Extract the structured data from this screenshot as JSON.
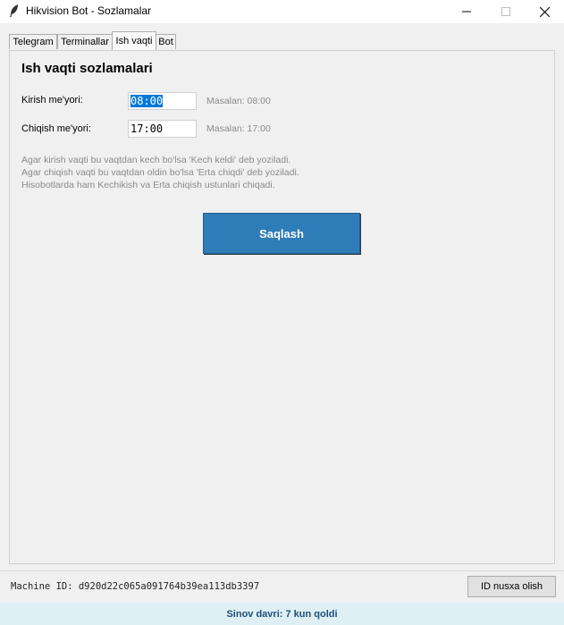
{
  "window": {
    "title": "Hikvision Bot - Sozlamalar"
  },
  "tabs": [
    {
      "label": "Telegram"
    },
    {
      "label": "Terminallar"
    },
    {
      "label": "Ish vaqti"
    },
    {
      "label": "Bot"
    }
  ],
  "settings": {
    "heading": "Ish vaqti sozlamalari",
    "checkin": {
      "label": "Kirish me'yori:",
      "value": "08:00",
      "hint": "Masalan: 08:00"
    },
    "checkout": {
      "label": "Chiqish me'yori:",
      "value": "17:00",
      "hint": "Masalan: 17:00"
    },
    "info": [
      "Agar kirish vaqti bu vaqtdan kech bo'lsa 'Kech keldi' deb yoziladi.",
      "Agar chiqish vaqti bu vaqtdan oldin bo'lsa 'Erta chiqdi' deb yoziladi.",
      "Hisobotlarda ham Kechikish va Erta chiqish ustunlari chiqadi."
    ],
    "save_label": "Saqlash"
  },
  "footer": {
    "machine_id": "Machine ID: d920d22c065a091764b39ea113db3397",
    "copy_label": "ID nusxa olish",
    "status": "Sinov davri: 7 kun qoldi"
  },
  "colors": {
    "accent": "#2e7db8",
    "status_bg": "#dff0f5",
    "status_text": "#1f4e79"
  }
}
